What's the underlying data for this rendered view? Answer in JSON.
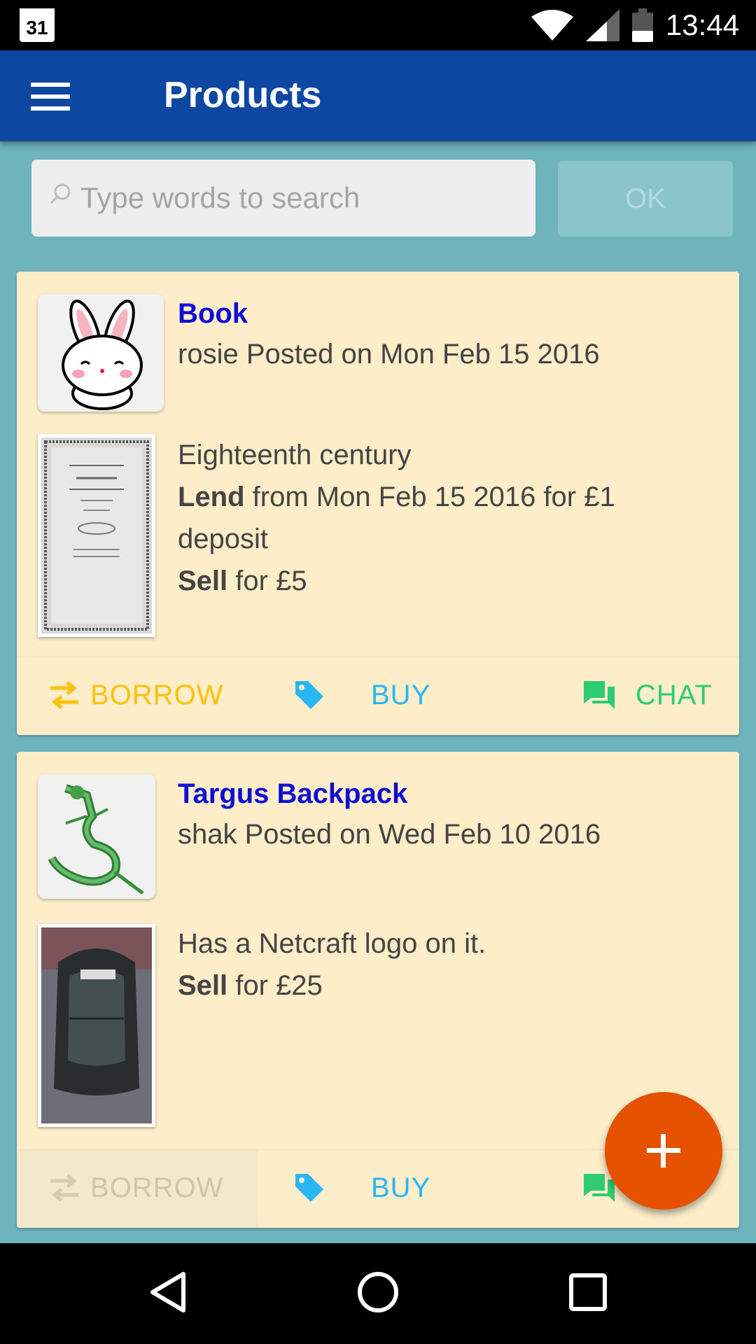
{
  "status_bar": {
    "calendar_day": "31",
    "time": "13:44"
  },
  "app_bar": {
    "title": "Products"
  },
  "search": {
    "placeholder": "Type words to search",
    "value": "",
    "ok_label": "OK"
  },
  "products": [
    {
      "title": "Book",
      "poster": "rosie Posted on Mon Feb 15 2016",
      "description": "Eighteenth century",
      "lend_label": "Lend",
      "lend_text": " from Mon Feb 15 2016 for £1 deposit",
      "sell_label": "Sell",
      "sell_text": " for £5",
      "borrow_label": "BORROW",
      "buy_label": "BUY",
      "chat_label": "CHAT"
    },
    {
      "title": "Targus Backpack",
      "poster": "shak Posted on Wed Feb 10 2016",
      "description": "Has a Netcraft logo on it.",
      "sell_label": "Sell",
      "sell_text": " for £25",
      "borrow_label": "BORROW",
      "buy_label": "BUY",
      "chat_label": "CH"
    }
  ],
  "colors": {
    "app_bar": "#0d47a1",
    "background": "#6fb3bd",
    "card": "#fdedc9",
    "title": "#0d0dd6",
    "borrow": "#ffc107",
    "buy": "#29b6f6",
    "chat": "#2ecc71",
    "fab": "#e65100"
  },
  "icons": {
    "menu": "hamburger-menu-icon",
    "search": "search-icon",
    "borrow": "swap-arrows-icon",
    "buy": "price-tag-icon",
    "chat": "chat-bubbles-icon",
    "fab": "plus-icon"
  }
}
